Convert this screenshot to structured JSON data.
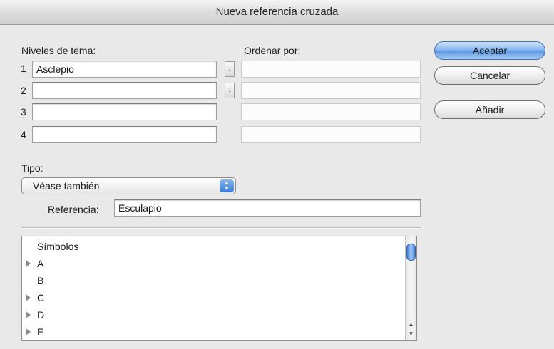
{
  "window": {
    "title": "Nueva referencia cruzada"
  },
  "levels": {
    "label": "Niveles de tema:",
    "sort_label": "Ordenar por:",
    "rows": [
      {
        "num": "1",
        "value": "Asclepio",
        "sort": ""
      },
      {
        "num": "2",
        "value": "",
        "sort": ""
      },
      {
        "num": "3",
        "value": "",
        "sort": ""
      },
      {
        "num": "4",
        "value": "",
        "sort": ""
      }
    ]
  },
  "buttons": {
    "accept": "Aceptar",
    "cancel": "Cancelar",
    "add": "Añadir"
  },
  "type": {
    "label": "Tipo:",
    "selected": "Véase también"
  },
  "reference": {
    "label": "Referencia:",
    "value": "Esculapio"
  },
  "list": {
    "items": [
      {
        "label": "Símbolos",
        "expandable": false
      },
      {
        "label": "A",
        "expandable": true
      },
      {
        "label": "B",
        "expandable": false
      },
      {
        "label": "C",
        "expandable": true
      },
      {
        "label": "D",
        "expandable": true
      },
      {
        "label": "E",
        "expandable": true
      }
    ]
  },
  "colors": {
    "accent": "#5d98e3",
    "window_bg": "#e9e9e9"
  }
}
